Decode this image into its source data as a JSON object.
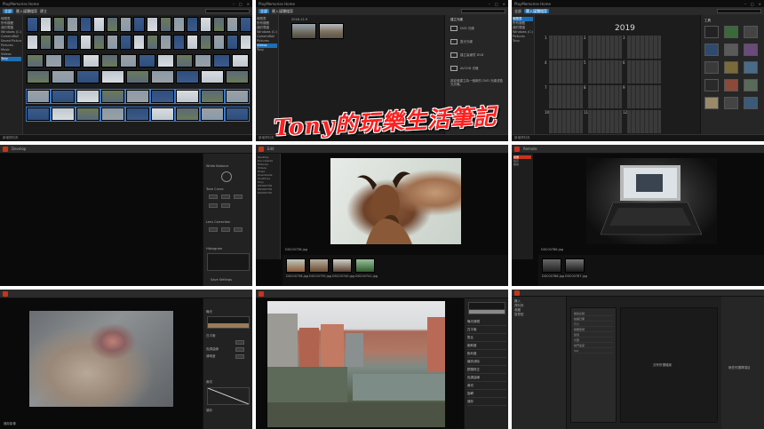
{
  "app_title": "PlayMemories Home",
  "banner_text": "Tony的玩樂生活筆記",
  "calendar_year": "2019",
  "image_filename": "DSC00738.jpg",
  "panel1": {
    "toolbar_tabs": [
      "全部",
      "匯入媒體檔案",
      "建立"
    ],
    "sidebar": [
      "時間表",
      "所有媒體",
      "我的電腦",
      "Windows (C:)",
      "CameraRoll",
      "Saved Pictures",
      "Pictures",
      "Music",
      "Videos",
      "Tony"
    ],
    "status": "新增資料夾"
  },
  "panel2": {
    "date": "2018-12-9",
    "options": [
      "DVD 光碟",
      "藍光光碟",
      "建立高畫質 DVD",
      "AVCHD 光碟",
      "建立光碟"
    ],
    "note": "將影像建立為一個新的 DVD 光碟或藍光光碟。",
    "sidebar": [
      "時間表",
      "所有媒體",
      "我的電腦",
      "Windows (C:)",
      "CameraRoll",
      "Pictures",
      "Videos",
      "Tony"
    ],
    "status": "新增資料夾"
  },
  "panel3": {
    "right_title": "工具",
    "months": [
      "1",
      "2",
      "3",
      "4",
      "5",
      "6",
      "7",
      "8",
      "9",
      "10",
      "11",
      "12"
    ],
    "sidebar": [
      "時間表",
      "所有媒體",
      "我的電腦",
      "Windows (C:)",
      "Pictures",
      "Tony"
    ],
    "status": "新增資料夾"
  },
  "panel4": {
    "tool": "Develop",
    "sections": [
      "White Balance",
      "Tone Curve",
      "Lens Correction",
      "Histogram",
      "Save Settings"
    ]
  },
  "panel5": {
    "tool": "Edit",
    "tree": [
      "Desktop",
      "Documents",
      "Pictures",
      "Videos",
      "Music",
      "Downloads",
      "OneDrive",
      "Tony",
      "DSC00738",
      "DSC00739",
      "DSC00740"
    ],
    "thumbs": [
      "DSC00738.jpg",
      "DSC00739.jpg",
      "DSC00740.jpg",
      "DSC00741.jpg"
    ]
  },
  "panel6": {
    "tool": "Remote",
    "tree": [
      "相機",
      "設定",
      "檔案"
    ],
    "thumbs": [
      "DSC00786.jpg",
      "DSC00787.jpg"
    ]
  },
  "panel7": {
    "sections": [
      "曝光",
      "白平衡",
      "色調曲線",
      "清晰度",
      "裁切",
      "儲存"
    ],
    "footer": "儲存影像"
  },
  "panel8": {
    "menu": [
      "曝光補償",
      "白平衡",
      "對比",
      "飽和度",
      "銳利度",
      "雜訊消除",
      "鏡頭修正",
      "色調曲線",
      "裁切",
      "旋轉",
      "儲存"
    ]
  },
  "panel9": {
    "left_items": [
      "匯入",
      "資料夾",
      "收藏",
      "智慧型"
    ],
    "props": [
      "檔案名稱",
      "拍攝日期",
      "尺寸",
      "相機型號",
      "鏡頭",
      "光圈",
      "快門速度",
      "ISO"
    ],
    "center_text": "沒有所選檔案",
    "right_text": "無任何選擇項目"
  }
}
